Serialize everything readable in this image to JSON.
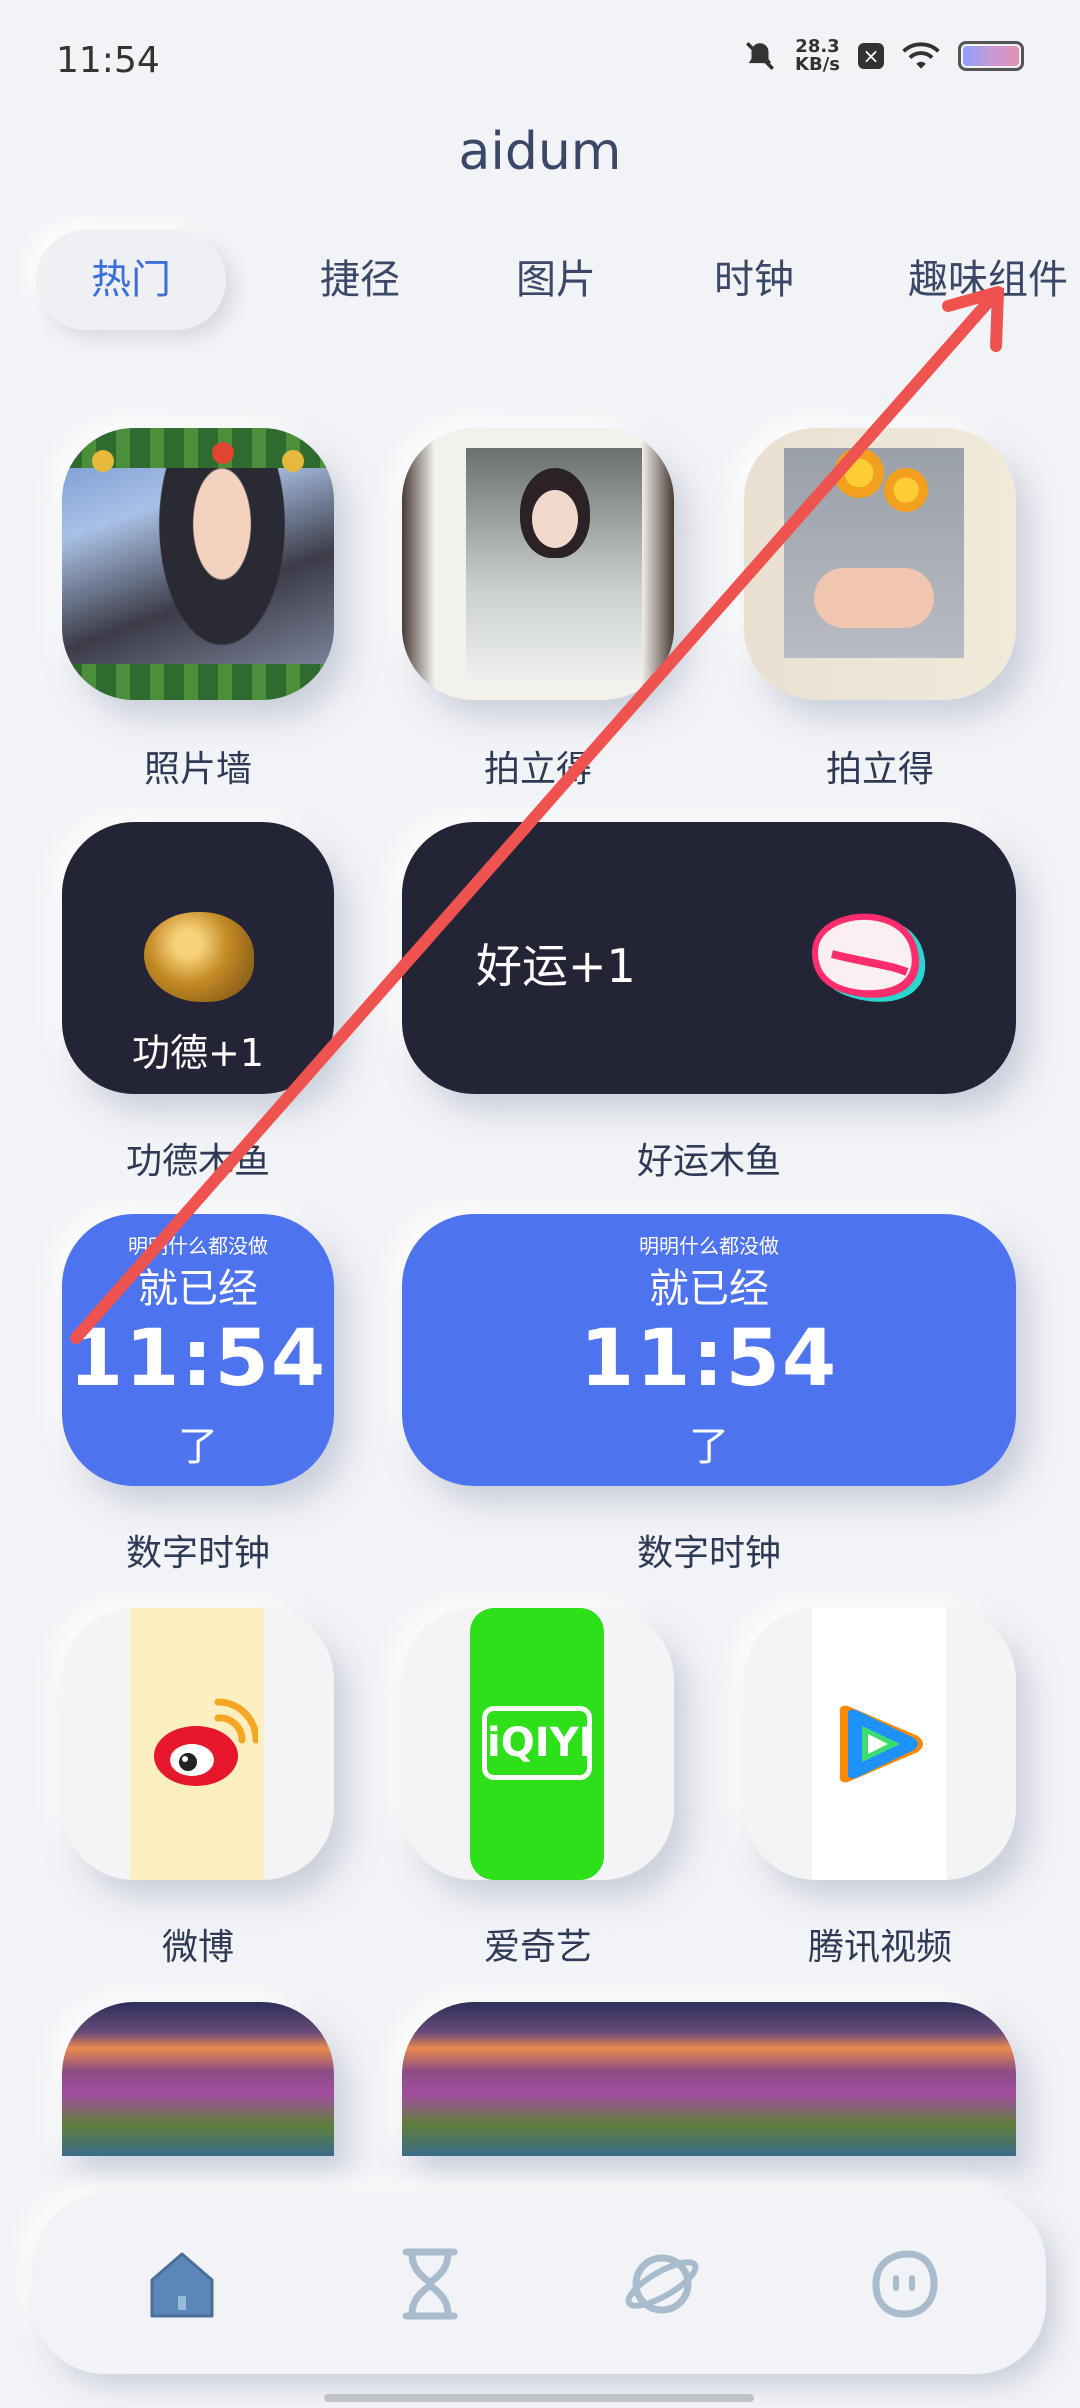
{
  "status_bar": {
    "time": "11:54",
    "net_speed_value": "28.3",
    "net_speed_unit": "KB/s"
  },
  "app": {
    "title": "aidum"
  },
  "tabs": [
    {
      "label": "热门",
      "active": true
    },
    {
      "label": "捷径",
      "active": false
    },
    {
      "label": "图片",
      "active": false
    },
    {
      "label": "时钟",
      "active": false
    },
    {
      "label": "趣味组件",
      "active": false
    }
  ],
  "widgets": {
    "photo_wall": {
      "label": "照片墙"
    },
    "polaroid_1": {
      "label": "拍立得"
    },
    "polaroid_2": {
      "label": "拍立得"
    },
    "merit_fish": {
      "tile_text": "功德+1",
      "label": "功德木鱼"
    },
    "luck_fish": {
      "tile_text": "好运+1",
      "label": "好运木鱼"
    },
    "clock_small": {
      "line1": "明明什么都没做",
      "line2": "就已经",
      "time": "11:54",
      "line3": "了",
      "label": "数字时钟"
    },
    "clock_wide": {
      "line1": "明明什么都没做",
      "line2": "就已经",
      "time": "11:54",
      "line3": "了",
      "label": "数字时钟"
    },
    "weibo": {
      "label": "微博",
      "strip_color": "#fdefc0"
    },
    "iqiyi": {
      "label": "爱奇艺",
      "logo_text": "iQIYI",
      "strip_color": "#2ee01a"
    },
    "tencent_video": {
      "label": "腾讯视频",
      "strip_color": "#ffffff"
    }
  },
  "bottom_nav": [
    {
      "icon": "home-icon"
    },
    {
      "icon": "hourglass-icon"
    },
    {
      "icon": "planet-icon"
    },
    {
      "icon": "ghost-face-icon"
    }
  ],
  "colors": {
    "accent_blue": "#4e73ef",
    "active_tab_text": "#3d6fd9",
    "dark_tile": "#232536",
    "annotation_arrow": "#ef5350"
  }
}
